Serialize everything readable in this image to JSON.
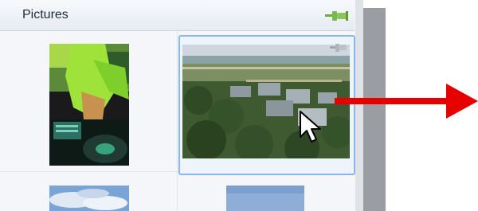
{
  "panel": {
    "title": "Pictures"
  },
  "icons": {
    "pin": "pin-icon",
    "cursor": "mouse-pointer-icon",
    "arrow": "red-arrow-icon"
  },
  "colors": {
    "accent_selected": "#8cb6e8",
    "arrow": "#e60000",
    "pin": "#6fae3f"
  },
  "thumbnails": [
    {
      "subject": "dj-photo",
      "selected": false
    },
    {
      "subject": "aerial-beach-houses",
      "selected": true
    },
    {
      "subject": "sky-clouds",
      "selected": false
    },
    {
      "subject": "blue-sky",
      "selected": false
    }
  ]
}
